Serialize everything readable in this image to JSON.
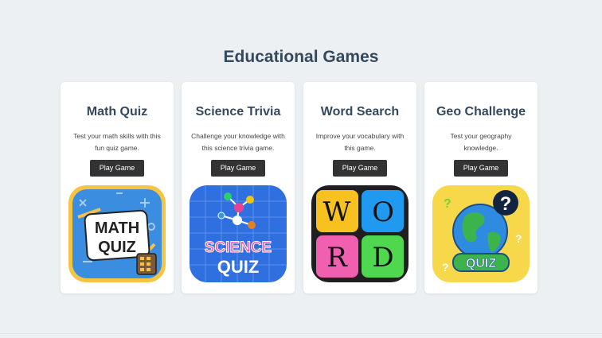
{
  "page": {
    "title": "Educational Games"
  },
  "games": [
    {
      "title": "Math Quiz",
      "description": "Test your math skills with this fun quiz game.",
      "button": "Play Game",
      "icon": "math-quiz-icon",
      "icon_text": [
        "MATH",
        "QUIZ"
      ]
    },
    {
      "title": "Science Trivia",
      "description": "Challenge your knowledge with this science trivia game.",
      "button": "Play Game",
      "icon": "science-quiz-icon",
      "icon_text": [
        "SCIENCE",
        "QUIZ"
      ]
    },
    {
      "title": "Word Search",
      "description": "Improve your vocabulary with this game.",
      "button": "Play Game",
      "icon": "word-tiles-icon",
      "icon_text": [
        "W",
        "O",
        "R",
        "D"
      ]
    },
    {
      "title": "Geo Challenge",
      "description": "Test your geography knowledge.",
      "button": "Play Game",
      "icon": "globe-quiz-icon",
      "icon_text": [
        "?",
        "QUIZ"
      ]
    }
  ],
  "colors": {
    "background": "#edf0f2",
    "card": "#ffffff",
    "button": "#333333",
    "heading": "#34495e"
  }
}
